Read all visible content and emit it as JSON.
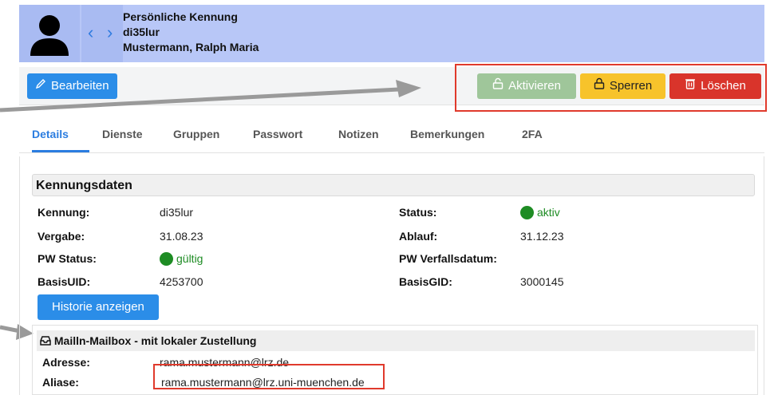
{
  "header": {
    "line1": "Persönliche Kennung",
    "line2": "di35lur",
    "line3": "Mustermann, Ralph Maria"
  },
  "toolbar": {
    "edit_label": "Bearbeiten",
    "activate_label": "Aktivieren",
    "lock_label": "Sperren",
    "delete_label": "Löschen"
  },
  "tabs": [
    {
      "label": "Details"
    },
    {
      "label": "Dienste"
    },
    {
      "label": "Gruppen"
    },
    {
      "label": "Passwort"
    },
    {
      "label": "Notizen"
    },
    {
      "label": "Bemerkungen"
    },
    {
      "label": "2FA"
    }
  ],
  "kennung": {
    "title": "Kennungsdaten",
    "kennung_label": "Kennung:",
    "kennung_value": "di35lur",
    "status_label": "Status:",
    "status_value": "aktiv",
    "vergabe_label": "Vergabe:",
    "vergabe_value": "31.08.23",
    "ablauf_label": "Ablauf:",
    "ablauf_value": "31.12.23",
    "pw_status_label": "PW Status:",
    "pw_status_value": "gültig",
    "pw_verfall_label": "PW Verfallsdatum:",
    "basisuid_label": "BasisUID:",
    "basisuid_value": "4253700",
    "basisgid_label": "BasisGID:",
    "basisgid_value": "3000145",
    "history_label": "Historie anzeigen"
  },
  "mail": {
    "title": "Mailln-Mailbox - mit lokaler Zustellung",
    "adresse_label": "Adresse:",
    "adresse_value": "rama.mustermann@lrz.de",
    "aliase_label": "Aliase:",
    "aliase_value": "rama.mustermann@lrz.uni-muenchen.de"
  },
  "colors": {
    "accent": "#2b8de8",
    "header_bg": "#b8c7f7",
    "status_green": "#1e8c24",
    "highlight_red": "#e03a2c"
  }
}
